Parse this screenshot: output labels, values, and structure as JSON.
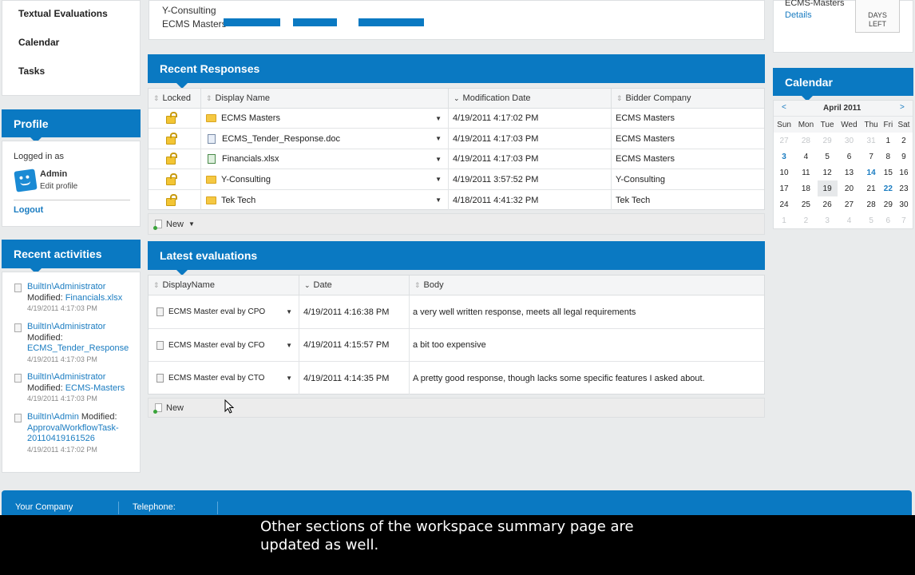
{
  "nav": {
    "items": [
      "Textual Evaluations",
      "Calendar",
      "Tasks"
    ]
  },
  "profile": {
    "header": "Profile",
    "logged_in_as": "Logged in as",
    "user": "Admin",
    "edit_profile": "Edit profile",
    "logout": "Logout"
  },
  "recent_activities": {
    "header": "Recent activities",
    "items": [
      {
        "user": "BuiltIn\\Administrator",
        "action": "Modified:",
        "target": "Financials.xlsx",
        "time": "4/19/2011 4:17:03 PM"
      },
      {
        "user": "BuiltIn\\Administrator",
        "action": "Modified:",
        "target": "ECMS_Tender_Response",
        "time": "4/19/2011 4:17:03 PM"
      },
      {
        "user": "BuiltIn\\Administrator",
        "action": "Modified:",
        "target": "ECMS-Masters",
        "time": "4/19/2011 4:17:03 PM"
      },
      {
        "user": "BuiltIn\\Admin",
        "action": "Modified:",
        "target": "ApprovalWorkflowTask-20110419161526",
        "time": "4/19/2011 4:17:02 PM"
      }
    ]
  },
  "top_chart": {
    "rows": [
      {
        "label": "Y-Consulting"
      },
      {
        "label": "ECMS Masters"
      }
    ],
    "accent": "#0a79c2"
  },
  "top_right": {
    "company": "ECMS-Masters",
    "details": "Details",
    "days_left_label_1": "DAYS",
    "days_left_label_2": "LEFT"
  },
  "recent_responses": {
    "header": "Recent Responses",
    "columns": [
      "Locked",
      "Display Name",
      "Modification Date",
      "Bidder Company"
    ],
    "rows": [
      {
        "icon": "folder-icon",
        "name": "ECMS Masters",
        "date": "4/19/2011 4:17:02 PM",
        "company": "ECMS Masters"
      },
      {
        "icon": "word-doc-icon",
        "name": "ECMS_Tender_Response.doc",
        "date": "4/19/2011 4:17:03 PM",
        "company": "ECMS Masters"
      },
      {
        "icon": "excel-icon",
        "name": "Financials.xlsx",
        "date": "4/19/2011 4:17:03 PM",
        "company": "ECMS Masters"
      },
      {
        "icon": "folder-icon",
        "name": "Y-Consulting",
        "date": "4/19/2011 3:57:52 PM",
        "company": "Y-Consulting"
      },
      {
        "icon": "folder-icon",
        "name": "Tek Tech",
        "date": "4/18/2011 4:41:32 PM",
        "company": "Tek Tech"
      }
    ],
    "new_label": "New"
  },
  "latest_evaluations": {
    "header": "Latest evaluations",
    "columns": [
      "DisplayName",
      "Date",
      "Body"
    ],
    "rows": [
      {
        "name": "ECMS Master eval by CPO",
        "date": "4/19/2011 4:16:38 PM",
        "body": "a very well written response, meets all legal requirements"
      },
      {
        "name": "ECMS Master eval by CFO",
        "date": "4/19/2011 4:15:57 PM",
        "body": "a bit too expensive"
      },
      {
        "name": "ECMS Master eval by CTO",
        "date": "4/19/2011 4:14:35 PM",
        "body": "A pretty good response, though lacks some specific features I asked about."
      }
    ],
    "new_label": "New"
  },
  "calendar": {
    "header": "Calendar",
    "prev": "<",
    "next": ">",
    "month": "April 2011",
    "weekdays": [
      "Sun",
      "Mon",
      "Tue",
      "Wed",
      "Thu",
      "Fri",
      "Sat"
    ],
    "weeks": [
      [
        "27",
        "28",
        "29",
        "30",
        "31",
        "1",
        "2"
      ],
      [
        "3",
        "4",
        "5",
        "6",
        "7",
        "8",
        "9"
      ],
      [
        "10",
        "11",
        "12",
        "13",
        "14",
        "15",
        "16"
      ],
      [
        "17",
        "18",
        "19",
        "20",
        "21",
        "22",
        "23"
      ],
      [
        "24",
        "25",
        "26",
        "27",
        "28",
        "29",
        "30"
      ],
      [
        "1",
        "2",
        "3",
        "4",
        "5",
        "6",
        "7"
      ]
    ]
  },
  "footer": {
    "company": "Your Company",
    "telephone": "Telephone:"
  },
  "subtitle": {
    "line1": "Other sections of the workspace summary page are",
    "line2": "updated as well."
  }
}
